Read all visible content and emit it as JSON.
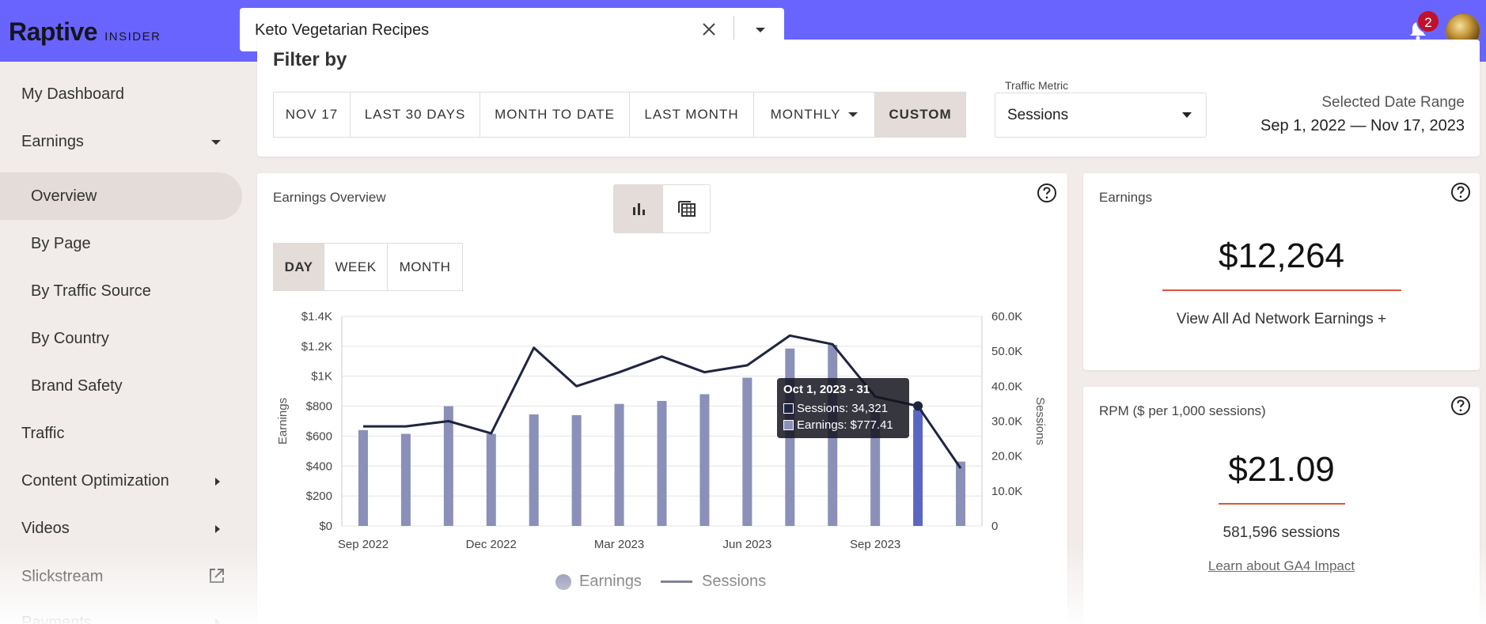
{
  "brand": {
    "name": "Raptive",
    "sub": "INSIDER"
  },
  "search": {
    "value": "Keto Vegetarian Recipes"
  },
  "notifications": {
    "count": "2"
  },
  "sidebar": {
    "items": [
      {
        "label": "My Dashboard"
      },
      {
        "label": "Earnings"
      },
      {
        "label": "Overview"
      },
      {
        "label": "By Page"
      },
      {
        "label": "By Traffic Source"
      },
      {
        "label": "By Country"
      },
      {
        "label": "Brand Safety"
      },
      {
        "label": "Traffic"
      },
      {
        "label": "Content Optimization"
      },
      {
        "label": "Videos"
      },
      {
        "label": "Slickstream"
      },
      {
        "label": "Payments"
      }
    ]
  },
  "filter": {
    "title": "Filter by",
    "buttons": [
      "NOV 17",
      "LAST 30 DAYS",
      "MONTH TO DATE",
      "LAST MONTH",
      "MONTHLY",
      "CUSTOM"
    ],
    "active": "CUSTOM",
    "traffic_metric_label": "Traffic Metric",
    "traffic_metric_value": "Sessions",
    "range_label": "Selected Date Range",
    "range_value": "Sep 1, 2022 — Nov 17, 2023"
  },
  "overview": {
    "title": "Earnings Overview",
    "periods": [
      "DAY",
      "WEEK",
      "MONTH"
    ],
    "active_period": "DAY",
    "legend": [
      "Earnings",
      "Sessions"
    ],
    "tooltip": {
      "title": "Oct 1, 2023 - 31",
      "sessions": "Sessions: 34,321",
      "earnings": "Earnings: $777.41"
    }
  },
  "earnings_card": {
    "title": "Earnings",
    "value": "$12,264",
    "link": "View All Ad Network Earnings +"
  },
  "rpm_card": {
    "title": "RPM ($ per 1,000 sessions)",
    "value": "$21.09",
    "sessions": "581,596 sessions",
    "link": "Learn about GA4 Impact"
  },
  "colors": {
    "topbar": "#6a64ff",
    "bar": "#8a90b8",
    "bar_highlight": "#5a67c2",
    "line": "#1e2540",
    "accent_red": "#e0533c"
  },
  "chart_data": {
    "type": "bar",
    "x": [
      "Sep 2022",
      "Oct 2022",
      "Nov 2022",
      "Dec 2022",
      "Jan 2023",
      "Feb 2023",
      "Mar 2023",
      "Apr 2023",
      "May 2023",
      "Jun 2023",
      "Jul 2023",
      "Aug 2023",
      "Sep 2023",
      "Oct 2023",
      "Nov 2023"
    ],
    "x_tick_labels": [
      "Sep 2022",
      "Dec 2022",
      "Mar 2023",
      "Jun 2023",
      "Sep 2023"
    ],
    "series": [
      {
        "name": "Earnings",
        "axis": "left",
        "type": "bar",
        "values": [
          640,
          615,
          800,
          615,
          745,
          740,
          815,
          835,
          880,
          990,
          1185,
          1210,
          790,
          777.41,
          430
        ]
      },
      {
        "name": "Sessions",
        "axis": "right",
        "type": "line",
        "values": [
          28500,
          28500,
          30000,
          26500,
          51000,
          40000,
          44000,
          48500,
          44000,
          46000,
          54500,
          52000,
          37000,
          34321,
          16500
        ]
      }
    ],
    "ylabel": "Earnings",
    "y2label": "Sessions",
    "ylim": [
      0,
      1400
    ],
    "y2lim": [
      0,
      60000
    ],
    "y_ticks": [
      "$0",
      "$200",
      "$400",
      "$600",
      "$800",
      "$1K",
      "$1.2K",
      "$1.4K"
    ],
    "y2_ticks": [
      "0",
      "10.0K",
      "20.0K",
      "30.0K",
      "40.0K",
      "50.0K",
      "60.0K"
    ],
    "highlight_index": 13,
    "grid": true,
    "legend": "bottom-center"
  }
}
